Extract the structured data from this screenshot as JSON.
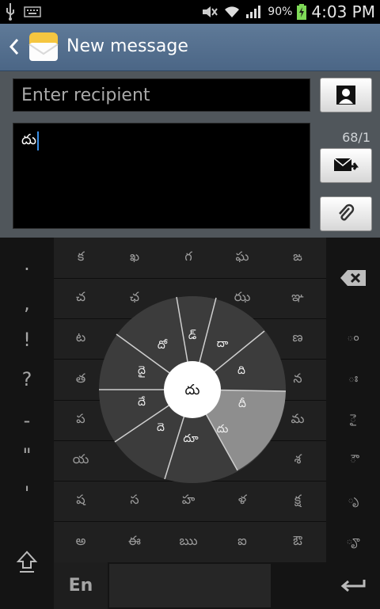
{
  "status_bar": {
    "battery_percent": "90%",
    "time": "4:03 PM",
    "icons": [
      "usb-icon",
      "keyboard-icon",
      "mute-icon",
      "wifi-icon",
      "signal-icon",
      "battery-charging-icon"
    ]
  },
  "header": {
    "title": "New message",
    "back_icon": "back-chevron-icon",
    "app_icon": "messaging-envelope-icon"
  },
  "compose": {
    "recipient_placeholder": "Enter recipient",
    "message_text": "దు",
    "char_counter": "68/1"
  },
  "keyboard": {
    "left_keys": [
      ".",
      ",",
      "!",
      "?",
      "-",
      "\"",
      "'"
    ],
    "rows": [
      [
        "క",
        "ఖ",
        "గ",
        "ఘ",
        "ఙ"
      ],
      [
        "చ",
        "ఛ",
        "",
        "ఝ",
        "ఞ"
      ],
      [
        "ట",
        "",
        "",
        "",
        "ణ"
      ],
      [
        "త",
        "",
        "",
        "",
        "న"
      ],
      [
        "ప",
        "",
        "",
        "",
        "మ"
      ],
      [
        "య",
        "",
        "",
        "",
        "శ"
      ],
      [
        "ష",
        "స",
        "హ",
        "ళ",
        "క్ష"
      ],
      [
        "అ",
        "ఈ",
        "ఋ",
        "ఐ",
        "ఔ"
      ]
    ],
    "right_keys": [
      "ం",
      "ః",
      "ై",
      "ౌ",
      "ృ",
      "ౄ"
    ],
    "lang_key": "En",
    "wheel_center": "దు",
    "wheel_options": [
      "డ్",
      "దా",
      "ది",
      "దీ",
      "దు",
      "దూ",
      "దె",
      "దే",
      "దై",
      "దో"
    ]
  }
}
